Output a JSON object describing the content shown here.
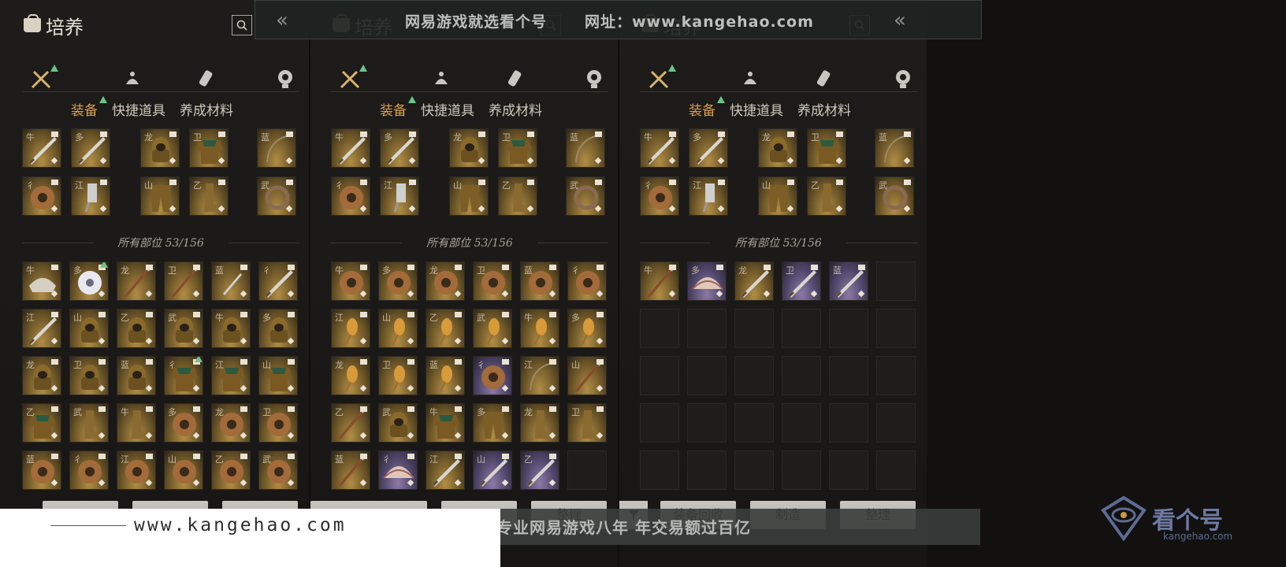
{
  "watermark": {
    "top_text": "网易游戏就选看个号",
    "top_url": "网址：www.kangehao.com",
    "bottom_url": "www.kangehao.com",
    "bottom_slogan": "看个号专业网易游戏八年  年交易额过百亿",
    "brand_name": "看个号",
    "brand_domain": "kangehao.com"
  },
  "panels": [
    {
      "title": "培养",
      "subtabs": [
        "装备",
        "快捷道具",
        "养成材料"
      ],
      "count_label": "所有部位 53/156",
      "buttons": []
    },
    {
      "title": "培养",
      "subtabs": [
        "装备",
        "快捷道具",
        "养成材料"
      ],
      "count_label": "所有部位 53/156",
      "buttons": [
        "整理"
      ]
    },
    {
      "title": "培养",
      "subtabs": [
        "装备",
        "快捷道具",
        "养成材料"
      ],
      "count_label": "所有部位 53/156",
      "buttons": [
        "装备回收",
        "制造",
        "整理"
      ]
    }
  ],
  "icons": {
    "title": "bag-icon",
    "search": "search-icon",
    "categories": [
      "equipment-crossed-swords-icon",
      "consumable-pouch-icon",
      "material-scroll-icon",
      "misc-ring-icon"
    ],
    "filter": "filter-icon"
  },
  "colors": {
    "active_tab": "#d9a14a",
    "new_indicator": "#6cc48a",
    "gold_item": "#b18e45",
    "purple_item": "#8d7aa6"
  }
}
